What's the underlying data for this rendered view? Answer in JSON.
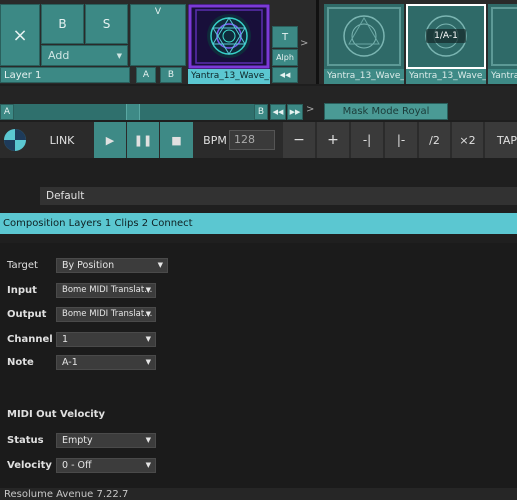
{
  "layer": {
    "name": "Layer 1",
    "close_glyph": "×",
    "b_label": "B",
    "s_label": "S",
    "add_label": "Add",
    "v_label": "V",
    "a_label": "A",
    "b_small": "B",
    "t_label": "T",
    "alph_label": "Alph",
    "next_glyph": ">"
  },
  "clips": [
    {
      "label": "Yantra_13_Wave_..."
    },
    {
      "label": "Yantra_13_Wave_..."
    },
    {
      "label": "Yantra_13_Wave_...",
      "badge": "1/A-1"
    },
    {
      "label": "Yantra_"
    }
  ],
  "crossfader": {
    "a_label": "A",
    "b_label": "B",
    "next_glyph": ">",
    "mask_mode": "Mask Mode Royal"
  },
  "transport": {
    "link": "LINK",
    "bpm_label": "BPM",
    "bpm_value": "128",
    "minus": "−",
    "plus": "+",
    "half": "/2",
    "double": "×2",
    "tap": "TAP"
  },
  "preset": {
    "name": "Default"
  },
  "banner": {
    "text": "Composition Layers 1 Clips 2 Connect"
  },
  "settings": {
    "target_label": "Target",
    "target_value": "By Position",
    "input_label": "Input",
    "input_value": "Bome MIDI Translat...",
    "output_label": "Output",
    "output_value": "Bome MIDI Translat...",
    "channel_label": "Channel",
    "channel_value": "1",
    "note_label": "Note",
    "note_value": "A-1",
    "velocity_section": "MIDI Out Velocity",
    "status_label": "Status",
    "status_value": "Empty",
    "velocity_label": "Velocity",
    "velocity_value": "0 - Off"
  },
  "footer": {
    "text": "Resolume Avenue 7.22.7"
  },
  "colors": {
    "accent": "#5bc7d1",
    "teal": "#3e8a86",
    "bg": "#1e1e1e"
  }
}
